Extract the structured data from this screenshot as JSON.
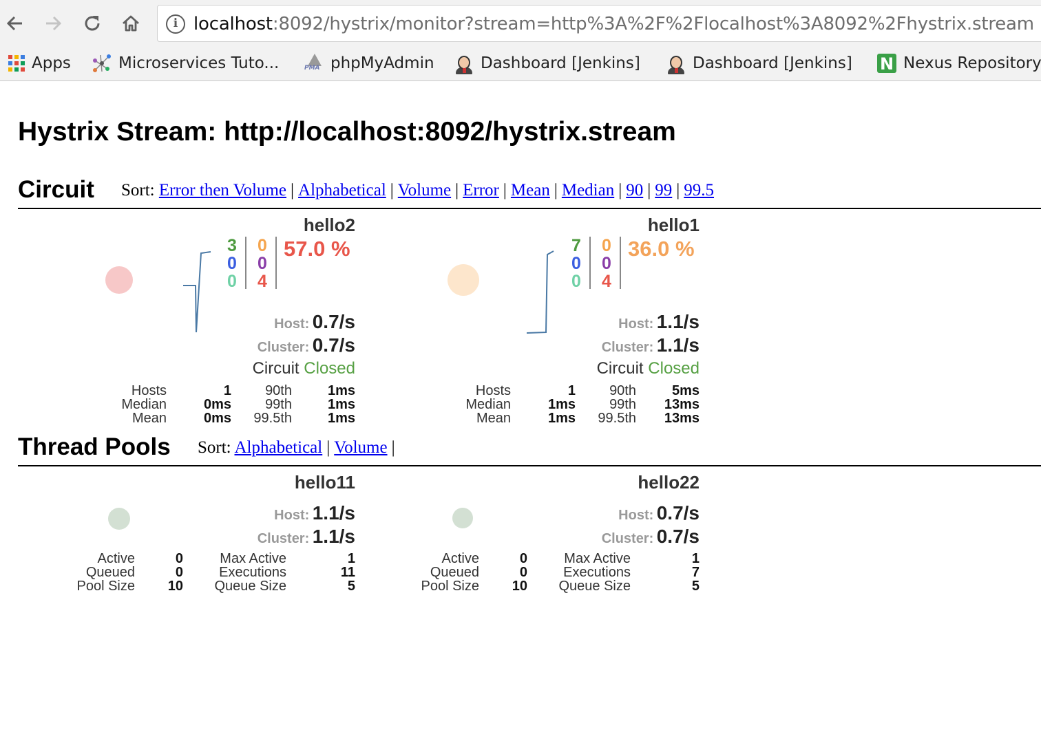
{
  "browser": {
    "url_host": "localhost",
    "url_rest": ":8092/hystrix/monitor?stream=http%3A%2F%2Flocalhost%3A8092%2Fhystrix.stream",
    "bookmarks": [
      {
        "label": "Apps",
        "icon": "apps-grid-icon"
      },
      {
        "label": "Microservices Tuto...",
        "icon": "network-icon"
      },
      {
        "label": "phpMyAdmin",
        "icon": "phpmyadmin-icon"
      },
      {
        "label": "Dashboard [Jenkins]",
        "icon": "jenkins-icon"
      },
      {
        "label": "Dashboard [Jenkins]",
        "icon": "jenkins-icon"
      },
      {
        "label": "Nexus Repository",
        "icon": "nexus-icon",
        "icon_letter": "N"
      }
    ]
  },
  "page": {
    "title": "Hystrix Stream: http://localhost:8092/hystrix.stream"
  },
  "circuit": {
    "heading": "Circuit",
    "sort_prefix": "Sort:",
    "sort_links": [
      "Error then Volume",
      "Alphabetical",
      "Volume",
      "Error",
      "Mean",
      "Median",
      "90",
      "99",
      "99.5"
    ],
    "cards": [
      {
        "name": "hello2",
        "counts_left": [
          "3",
          "0",
          "0"
        ],
        "counts_right": [
          "0",
          "0",
          "4"
        ],
        "error_rate": "57.0 %",
        "error_color": "#e8564a",
        "bubble_color": "#f7c8c8",
        "host_label": "Host:",
        "host_rate": "0.7/s",
        "cluster_label": "Cluster:",
        "cluster_rate": "0.7/s",
        "status_prefix": "Circuit",
        "status": "Closed",
        "stats_labels_1": [
          "Hosts",
          "Median",
          "Mean"
        ],
        "stats_values_1": [
          "1",
          "0ms",
          "0ms"
        ],
        "stats_labels_2": [
          "90th",
          "99th",
          "99.5th"
        ],
        "stats_values_2": [
          "1ms",
          "1ms",
          "1ms"
        ]
      },
      {
        "name": "hello1",
        "counts_left": [
          "7",
          "0",
          "0"
        ],
        "counts_right": [
          "0",
          "0",
          "4"
        ],
        "error_rate": "36.0 %",
        "error_color": "#f3a35a",
        "bubble_color": "#fde6cc",
        "host_label": "Host:",
        "host_rate": "1.1/s",
        "cluster_label": "Cluster:",
        "cluster_rate": "1.1/s",
        "status_prefix": "Circuit",
        "status": "Closed",
        "stats_labels_1": [
          "Hosts",
          "Median",
          "Mean"
        ],
        "stats_values_1": [
          "1",
          "1ms",
          "1ms"
        ],
        "stats_labels_2": [
          "90th",
          "99th",
          "99.5th"
        ],
        "stats_values_2": [
          "5ms",
          "13ms",
          "13ms"
        ]
      }
    ]
  },
  "thread_pools": {
    "heading": "Thread Pools",
    "sort_prefix": "Sort:",
    "sort_links": [
      "Alphabetical",
      "Volume"
    ],
    "cards": [
      {
        "name": "hello11",
        "host_label": "Host:",
        "host_rate": "1.1/s",
        "cluster_label": "Cluster:",
        "cluster_rate": "1.1/s",
        "labels_1": [
          "Active",
          "Queued",
          "Pool Size"
        ],
        "values_1": [
          "0",
          "0",
          "10"
        ],
        "labels_2": [
          "Max Active",
          "Executions",
          "Queue Size"
        ],
        "values_2": [
          "1",
          "11",
          "5"
        ]
      },
      {
        "name": "hello22",
        "host_label": "Host:",
        "host_rate": "0.7/s",
        "cluster_label": "Cluster:",
        "cluster_rate": "0.7/s",
        "labels_1": [
          "Active",
          "Queued",
          "Pool Size"
        ],
        "values_1": [
          "0",
          "0",
          "10"
        ],
        "labels_2": [
          "Max Active",
          "Executions",
          "Queue Size"
        ],
        "values_2": [
          "1",
          "7",
          "5"
        ]
      }
    ]
  },
  "colors": {
    "count_green": "#4e9a3f",
    "count_blue": "#3b5ee0",
    "count_teal": "#6fd1a6",
    "count_orange": "#f5a54e",
    "count_purple": "#8a3ea8",
    "count_red": "#e8564a",
    "status_green": "#56a043",
    "pool_bubble": "#d3e0d3"
  }
}
